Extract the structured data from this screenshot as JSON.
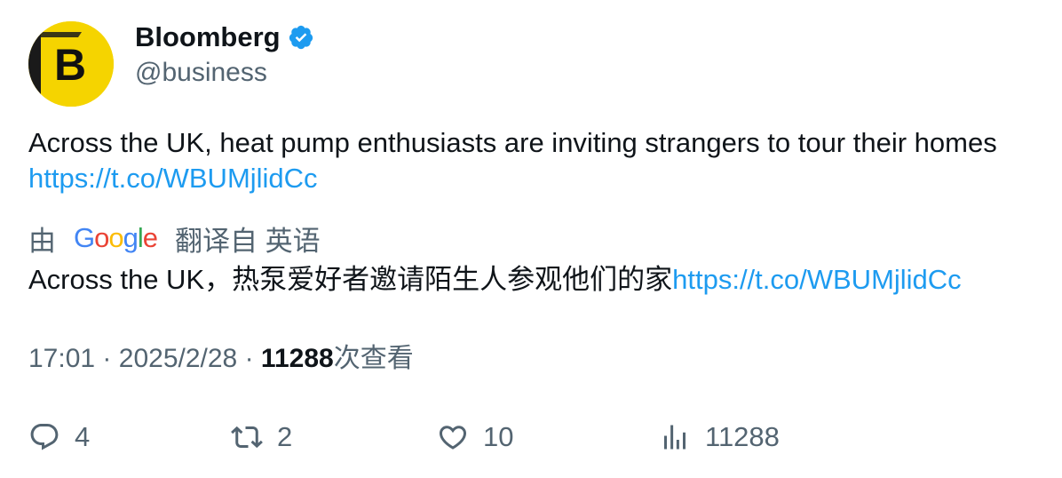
{
  "author": {
    "display_name": "Bloomberg",
    "handle": "@business",
    "avatar_letter": "B",
    "avatar_color": "#f5d400",
    "verified_icon": "verified-badge-icon",
    "verified_color": "#1d9bf0"
  },
  "tweet": {
    "text": "Across the UK, heat pump enthusiasts are inviting strangers to tour their homes",
    "link": "https://t.co/WBUMjlidCc"
  },
  "translation": {
    "prefix": "由",
    "provider": "Google",
    "suffix": "翻译自 英语",
    "text": "Across the UK，热泵爱好者邀请陌生人参观他们的家",
    "link": "https://t.co/WBUMjlidCc"
  },
  "meta": {
    "time": "17:01",
    "separator": "·",
    "date": "2025/2/28",
    "views_count": "11288",
    "views_label": "次查看"
  },
  "actions": {
    "replies": "4",
    "retweets": "2",
    "likes": "10",
    "views": "11288"
  },
  "colors": {
    "link": "#1d9bf0",
    "secondary_text": "#536471",
    "primary_text": "#0f1419"
  }
}
